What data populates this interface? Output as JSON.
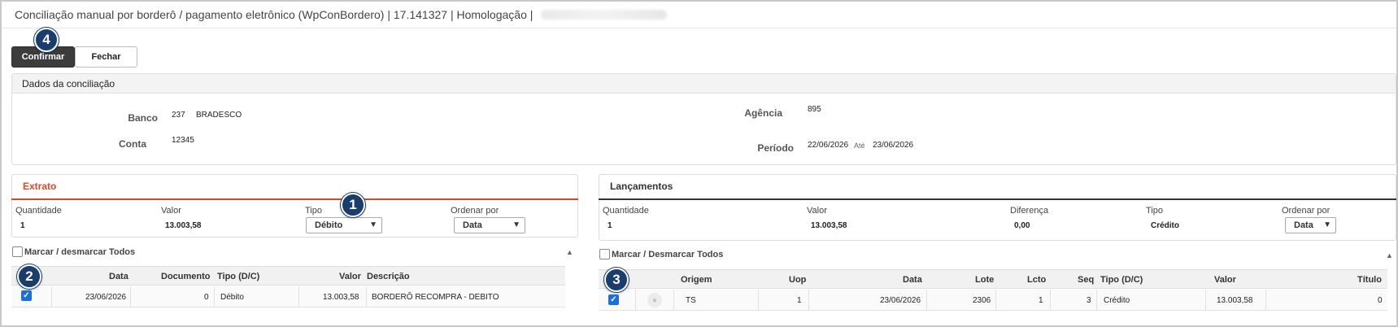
{
  "window": {
    "title": "Conciliação manual por borderô / pagamento eletrônico (WpConBordero) | 17.141327 | Homologação |"
  },
  "toolbar": {
    "confirm_label": "Confirmar",
    "close_label": "Fechar"
  },
  "markers": [
    "1",
    "2",
    "3",
    "4"
  ],
  "dados": {
    "title": "Dados da conciliação",
    "banco_label": "Banco",
    "banco_code": "237",
    "banco_name": "BRADESCO",
    "conta_label": "Conta",
    "conta_value": "12345",
    "agencia_label": "Agência",
    "agencia_value": "895",
    "periodo_label": "Período",
    "periodo_from": "22/06/2026",
    "periodo_ate": "Até",
    "periodo_to": "23/06/2026"
  },
  "extrato": {
    "title": "Extrato",
    "quantidade_label": "Quantidade",
    "quantidade_value": "1",
    "valor_label": "Valor",
    "valor_value": "13.003,58",
    "tipo_label": "Tipo",
    "tipo_selected": "Débito",
    "ordenar_label": "Ordenar por",
    "ordenar_selected": "Data",
    "mark_all_label": "Marcar / desmarcar Todos",
    "columns": [
      "Data",
      "Documento",
      "Tipo (D/C)",
      "Valor",
      "Descrição"
    ],
    "rows": [
      {
        "checked": true,
        "data": "23/06/2026",
        "documento": "0",
        "tipo": "Débito",
        "valor": "13.003,58",
        "descricao": "BORDERÔ RECOMPRA - DEBITO"
      }
    ]
  },
  "lancamentos": {
    "title": "Lançamentos",
    "quantidade_label": "Quantidade",
    "quantidade_value": "1",
    "valor_label": "Valor",
    "valor_value": "13.003,58",
    "diferenca_label": "Diferença",
    "diferenca_value": "0,00",
    "tipo_label": "Tipo",
    "tipo_value": "Crédito",
    "ordenar_label": "Ordenar por",
    "ordenar_selected": "Data",
    "mark_all_label": "Marcar / Desmarcar Todos",
    "columns": [
      "Origem",
      "Uop",
      "Data",
      "Lote",
      "Lcto",
      "Seq",
      "Tipo (D/C)",
      "Valor",
      "Título"
    ],
    "rows": [
      {
        "checked": true,
        "origem": "TS",
        "uop": "1",
        "data": "23/06/2026",
        "lote": "2306",
        "lcto": "1",
        "seq": "3",
        "tipo": "Crédito",
        "valor": "13.003,58",
        "titulo": "0"
      }
    ]
  },
  "colors": {
    "extrato_accent": "#d9472b",
    "lancamentos_accent": "#333333",
    "marker_bg": "#1a3d6d",
    "checkbox_on": "#1d6fd8"
  },
  "icons": {
    "sort_up": "▲",
    "caret": "▼",
    "check": "✓",
    "magnifier": "🔍"
  }
}
